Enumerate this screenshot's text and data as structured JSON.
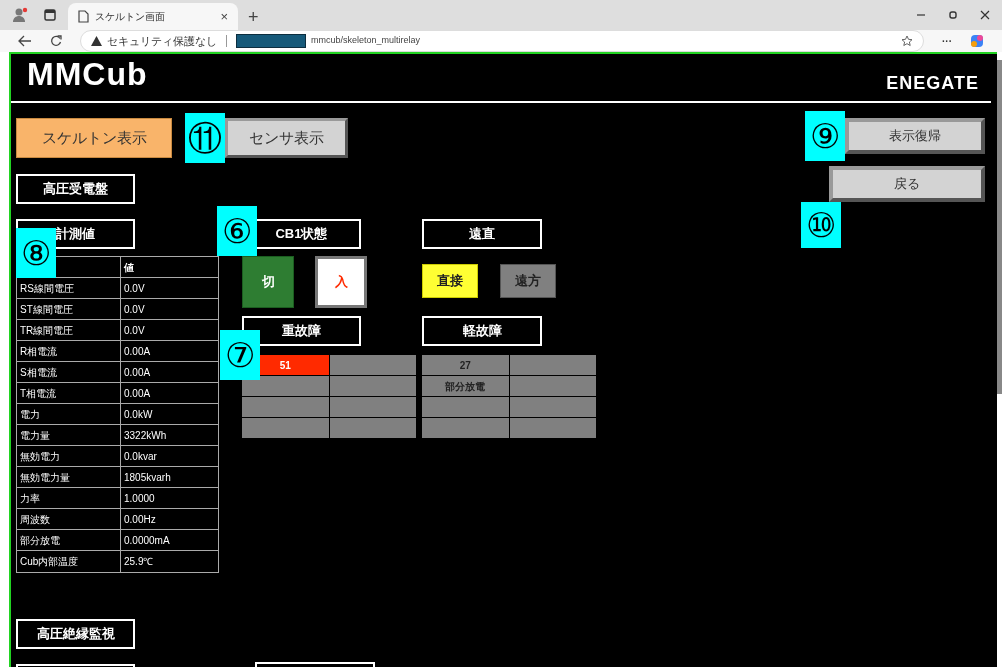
{
  "browser": {
    "tab_title": "スケルトン画面",
    "tab_close": "×",
    "new_tab": "+",
    "security_warning": "セキュリティ保護なし",
    "url": "mmcub/skeleton_multirelay",
    "more": "···"
  },
  "header": {
    "logo": "MMCub",
    "brand": "ENEGATE"
  },
  "mode_buttons": [
    {
      "label": "スケルトン表示",
      "selected": true
    },
    {
      "label": "センサ表示",
      "selected": false,
      "marker": "⑪"
    }
  ],
  "right_buttons": [
    {
      "label": "表示復帰",
      "marker": "⑨"
    },
    {
      "label": "戻る",
      "marker": "⑩"
    }
  ],
  "panel_title": "高圧受電盤",
  "measurement": {
    "title": "計測値",
    "marker": "⑧",
    "value_header": "値",
    "rows": [
      {
        "item": "RS線間電圧",
        "value": "0.0V"
      },
      {
        "item": "ST線間電圧",
        "value": "0.0V"
      },
      {
        "item": "TR線間電圧",
        "value": "0.0V"
      },
      {
        "item": "R相電流",
        "value": "0.00A"
      },
      {
        "item": "S相電流",
        "value": "0.00A"
      },
      {
        "item": "T相電流",
        "value": "0.00A"
      },
      {
        "item": "電力",
        "value": "0.0kW"
      },
      {
        "item": "電力量",
        "value": "3322kWh"
      },
      {
        "item": "無効電力",
        "value": "0.0kvar"
      },
      {
        "item": "無効電力量",
        "value": "1805kvarh"
      },
      {
        "item": "力率",
        "value": "1.0000"
      },
      {
        "item": "周波数",
        "value": "0.00Hz"
      },
      {
        "item": "部分放電",
        "value": "0.0000mA"
      },
      {
        "item": "Cub内部温度",
        "value": "25.9℃"
      }
    ]
  },
  "cb_status": {
    "title": "CB1状態",
    "marker": "⑥",
    "buttons": [
      {
        "label": "切",
        "kind": "off",
        "lit": true
      },
      {
        "label": "入",
        "kind": "on",
        "lit": false
      }
    ]
  },
  "remote_direct": {
    "title": "遠直",
    "options": [
      {
        "label": "直接",
        "selected": true
      },
      {
        "label": "遠方",
        "selected": false
      }
    ]
  },
  "heavy_fault": {
    "title": "重故障",
    "marker": "⑦",
    "cells": [
      {
        "label": "51",
        "active": true
      },
      {
        "active": false
      },
      {
        "active": false
      },
      {
        "active": false
      },
      {
        "active": false
      },
      {
        "active": false
      },
      {
        "active": false
      },
      {
        "active": false
      }
    ]
  },
  "light_fault": {
    "title": "軽故障",
    "cells": [
      {
        "label": "27",
        "active": false
      },
      {
        "active": false
      },
      {
        "label": "部分放電",
        "active": false
      },
      {
        "active": false
      },
      {
        "active": false
      },
      {
        "active": false
      },
      {
        "active": false
      },
      {
        "active": false
      }
    ]
  },
  "insulation_title": "高圧絶縁監視"
}
